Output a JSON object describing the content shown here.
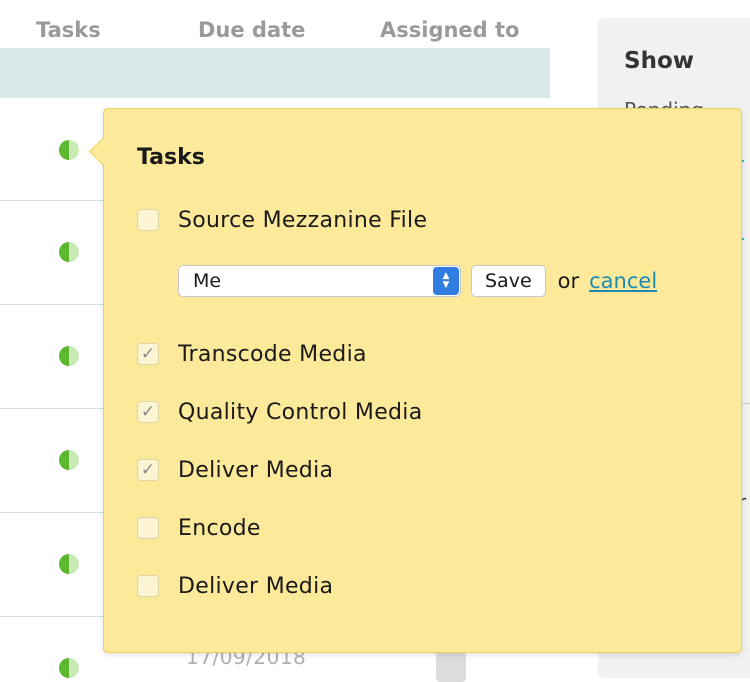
{
  "table": {
    "columns": [
      "Tasks",
      "Due date",
      "Assigned to"
    ],
    "partial_date": "17/09/2018"
  },
  "side_panel": {
    "title": "Show",
    "subtitle_partial": "Pending",
    "link_fragment": "i",
    "text_fragment": "r"
  },
  "popover": {
    "title": "Tasks",
    "first_task": {
      "label": "Source Mezzanine File",
      "checked": false
    },
    "assign": {
      "select_value": "Me",
      "save_label": "Save",
      "or_text": "or",
      "cancel_label": "cancel"
    },
    "tasks": [
      {
        "label": "Transcode Media",
        "checked": true
      },
      {
        "label": "Quality Control Media",
        "checked": true
      },
      {
        "label": "Deliver Media",
        "checked": true
      },
      {
        "label": "Encode",
        "checked": false
      },
      {
        "label": "Deliver Media",
        "checked": false
      }
    ]
  },
  "colors": {
    "popover_bg": "#fce99a",
    "link": "#1c8bb5",
    "status_green": "#5cb82e",
    "select_accent": "#2f7de1"
  }
}
